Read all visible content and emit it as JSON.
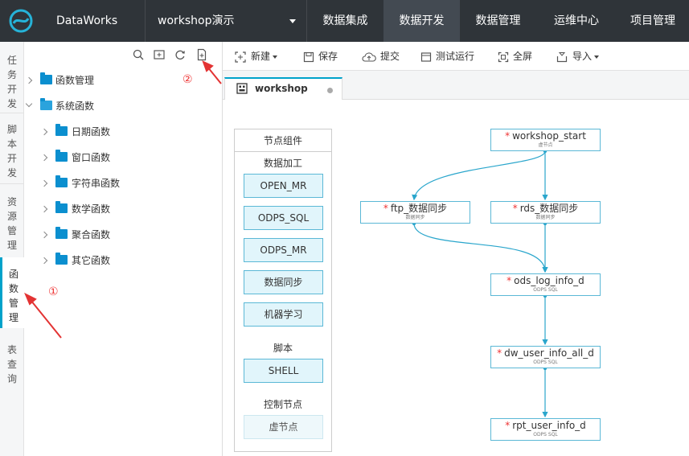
{
  "topbar": {
    "brand": "DataWorks",
    "project": "workshop演示",
    "nav": [
      "数据集成",
      "数据开发",
      "数据管理",
      "运维中心",
      "项目管理"
    ],
    "active_nav": "数据开发"
  },
  "left_tabs": [
    "任务开发",
    "脚本开发",
    "资源管理",
    "函数管理",
    "表查询"
  ],
  "active_left_tab": "函数管理",
  "tree": {
    "items": [
      {
        "label": "函数管理",
        "level": 0,
        "open": false
      },
      {
        "label": "系统函数",
        "level": 0,
        "open": true
      },
      {
        "label": "日期函数",
        "level": 1,
        "open": false
      },
      {
        "label": "窗口函数",
        "level": 1,
        "open": false
      },
      {
        "label": "字符串函数",
        "level": 1,
        "open": false
      },
      {
        "label": "数学函数",
        "level": 1,
        "open": false
      },
      {
        "label": "聚合函数",
        "level": 1,
        "open": false
      },
      {
        "label": "其它函数",
        "level": 1,
        "open": false
      }
    ],
    "tools": [
      "search-icon",
      "new-folder-icon",
      "refresh-icon",
      "new-file-icon"
    ]
  },
  "toolbar": {
    "new": "新建",
    "save": "保存",
    "submit": "提交",
    "test_run": "测试运行",
    "fullscreen": "全屏",
    "import": "导入"
  },
  "editor_tab": {
    "label": "workshop"
  },
  "palette": {
    "title": "节点组件",
    "section_data": "数据加工",
    "data_nodes": [
      "OPEN_MR",
      "ODPS_SQL",
      "ODPS_MR",
      "数据同步",
      "机器学习"
    ],
    "section_script": "脚本",
    "script_nodes": [
      "SHELL"
    ],
    "section_control": "控制节点",
    "control_nodes": [
      "虚节点"
    ]
  },
  "nodes": [
    {
      "name": "workshop_start",
      "type": "虚节点"
    },
    {
      "name": "ftp_数据同步",
      "type": "数据同步"
    },
    {
      "name": "rds_数据同步",
      "type": "数据同步"
    },
    {
      "name": "ods_log_info_d",
      "type": "ODPS SQL"
    },
    {
      "name": "dw_user_info_all_d",
      "type": "ODPS SQL"
    },
    {
      "name": "rpt_user_info_d",
      "type": "ODPS SQL"
    }
  ],
  "annotations": {
    "one": "①",
    "two": "②"
  },
  "colors": {
    "accent": "#00a2ca",
    "topbar": "#2f3439",
    "arrow": "#e33333"
  }
}
